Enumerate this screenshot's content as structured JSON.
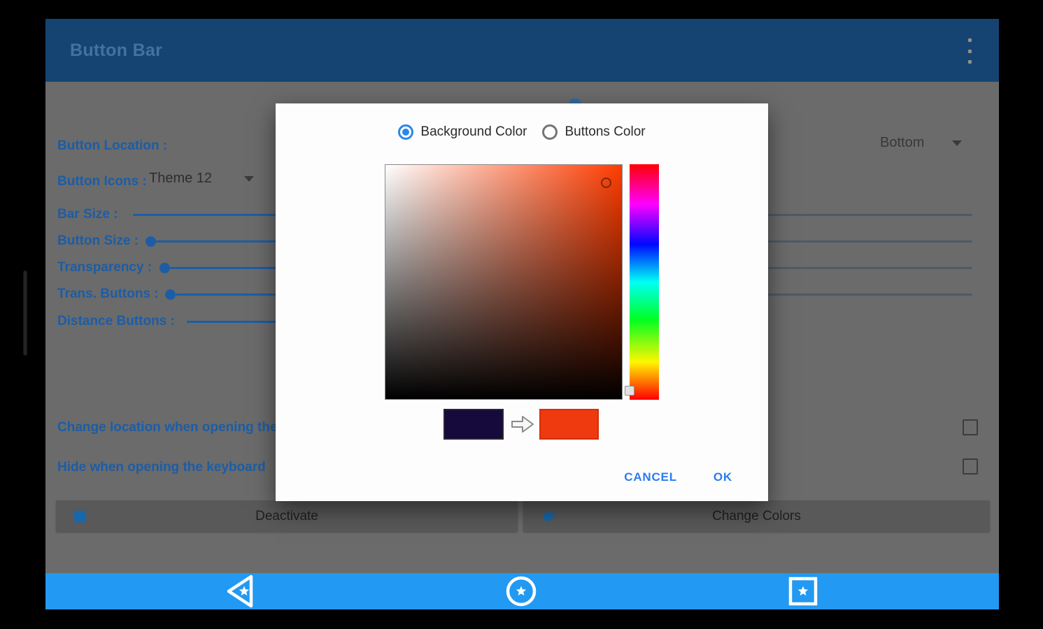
{
  "app_bar": {
    "title": "Button Bar"
  },
  "settings": {
    "button_location_label": "Button Location :",
    "button_location_value": "Bottom",
    "button_icons_label": "Button Icons :",
    "button_icons_value": "Theme 12",
    "bar_size_label": "Bar Size :",
    "button_size_label": "Button Size :",
    "transparency_label": "Transparency :",
    "trans_buttons_label": "Trans. Buttons :",
    "distance_buttons_label": "Distance Buttons :",
    "change_location_label": "Change location when opening the",
    "hide_keyboard_label": "Hide when opening the keyboard",
    "checkboxes_checked": false,
    "deactivate_label": "Deactivate",
    "change_colors_label": "Change Colors"
  },
  "dialog": {
    "background_color_option": "Background Color",
    "buttons_color_option": "Buttons Color",
    "selected_option": "Background Color",
    "current_color": "#160A3C",
    "new_color": "#EE3A0E",
    "current_color_style": "background:#160A3C",
    "new_color_style": "background:#EE3A0E",
    "cancel_label": "CANCEL",
    "ok_label": "OK"
  },
  "colors": {
    "app_bar_bg": "#164472",
    "accent_blue": "#1C5DA6",
    "overlay_bar_bg": "#2299F2",
    "dialog_action_blue": "#2B7CF0",
    "hue_selected": "#FF3C00"
  }
}
